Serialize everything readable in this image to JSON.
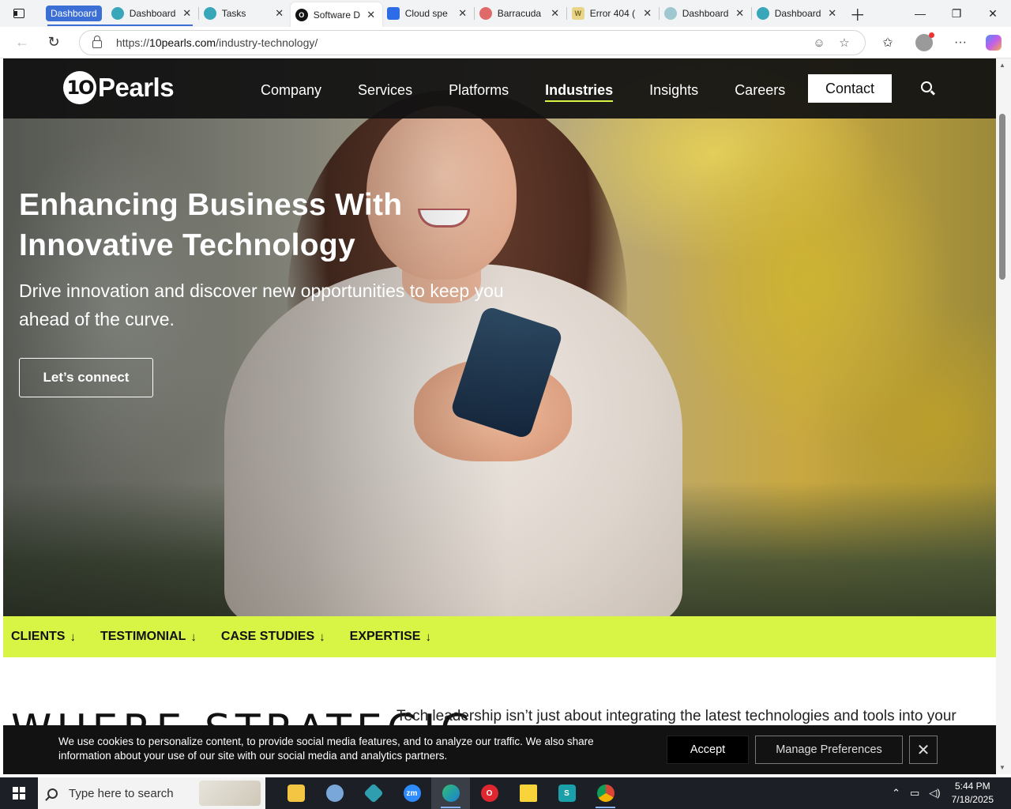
{
  "browser": {
    "group_label": "Dashboard",
    "tabs": [
      {
        "label": "Dashboard",
        "favicon": "teal-circle-icon",
        "active": false
      },
      {
        "label": "Tasks",
        "favicon": "teal-circle-icon",
        "active": false
      },
      {
        "label": "Software D",
        "favicon": "10pearls-icon",
        "active": true
      },
      {
        "label": "Cloud spe",
        "favicon": "doc-icon",
        "active": false
      },
      {
        "label": "Barracuda",
        "favicon": "barracuda-icon",
        "active": false
      },
      {
        "label": "Error 404 (",
        "favicon": "w-icon",
        "active": false
      },
      {
        "label": "Dashboard",
        "favicon": "teal-circle-icon",
        "active": false
      },
      {
        "label": "Dashboard",
        "favicon": "teal-circle-icon",
        "active": false
      }
    ],
    "url_prefix": "https://",
    "url_domain": "10pearls.com",
    "url_path": "/industry-technology/"
  },
  "site": {
    "logo_mark": "1O",
    "logo_text": "Pearls",
    "nav": [
      "Company",
      "Services",
      "Platforms",
      "Industries",
      "Insights",
      "Careers"
    ],
    "active_nav": "Industries",
    "contact_label": "Contact"
  },
  "hero": {
    "title": "Enhancing Business With Innovative Technology",
    "subtitle": "Drive innovation and discover new opportunities to keep you ahead of the curve.",
    "cta": "Let’s connect"
  },
  "anchors": [
    {
      "label": "CLIENTS",
      "arrow": "↓"
    },
    {
      "label": "TESTIMONIAL",
      "arrow": "↓"
    },
    {
      "label": "CASE STUDIES",
      "arrow": "↓"
    },
    {
      "label": "EXPERTISE",
      "arrow": "↓"
    }
  ],
  "section": {
    "heading": "WHERE STRATEGIC",
    "text": "Tech leadership isn’t just about integrating the latest technologies and tools into your"
  },
  "cookie": {
    "text": "We use cookies to personalize content, to provide social media features, and to analyze our traffic. We also share information about your use of our site with our social media and analytics partners.",
    "accept": "Accept",
    "manage": "Manage Preferences",
    "close": "✕"
  },
  "taskbar": {
    "search_placeholder": "Type here to search",
    "time": "5:44 PM",
    "date": "7/18/2025"
  },
  "colors": {
    "accent_lime": "#d8f545",
    "header_bg": "#121212",
    "tab_group_blue": "#3b6fd6"
  }
}
